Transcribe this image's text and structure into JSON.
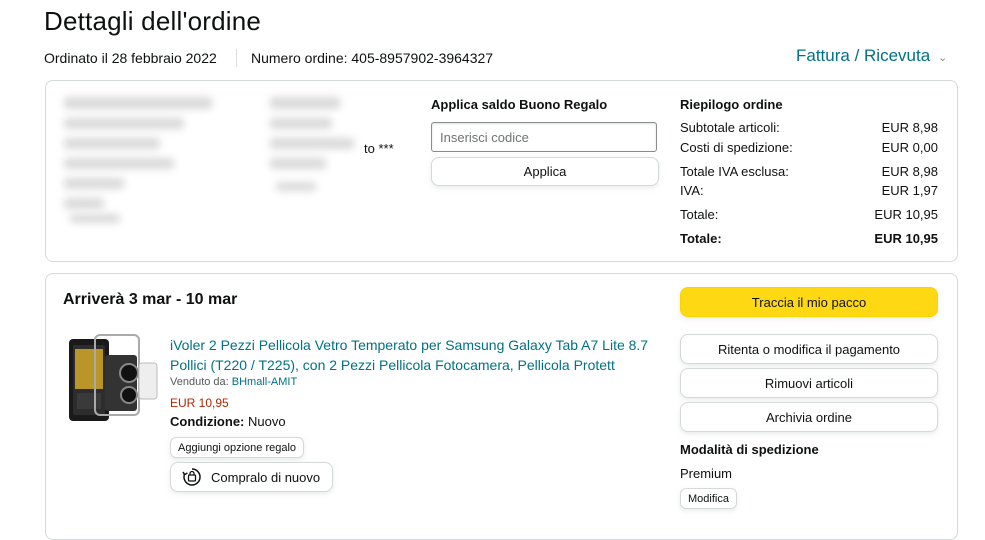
{
  "header": {
    "title": "Dettagli dell'ordine",
    "order_date": "Ordinato il 28 febbraio 2022",
    "order_number": "Numero ordine: 405-8957902-3964327",
    "invoice_link": "Fattura / Ricevuta"
  },
  "address": {
    "suffix": "to ***"
  },
  "gift_card": {
    "title": "Applica saldo Buono Regalo",
    "placeholder": "Inserisci codice",
    "value": "",
    "apply_label": "Applica"
  },
  "summary": {
    "title": "Riepilogo ordine",
    "rows": [
      {
        "label": "Subtotale articoli:",
        "value": "EUR 8,98"
      },
      {
        "label": "Costi di spedizione:",
        "value": "EUR 0,00"
      },
      {
        "label": "Totale IVA esclusa:",
        "value": "EUR 8,98"
      },
      {
        "label": "IVA:",
        "value": "EUR 1,97"
      },
      {
        "label": "Totale:",
        "value": "EUR 10,95"
      },
      {
        "label": "Totale:",
        "value": "EUR 10,95"
      }
    ]
  },
  "shipment": {
    "arrival": "Arriverà 3 mar - 10 mar",
    "product": {
      "title": "iVoler 2 Pezzi Pellicola Vetro Temperato per Samsung Galaxy Tab A7 Lite 8.7 Pollici (T220 / T225), con 2 Pezzi Pellicola Fotocamera, Pellicola Protett",
      "sold_by_label": "Venduto da: ",
      "seller": "BHmall-AMIT",
      "price": "EUR 10,95",
      "condition_label": "Condizione:",
      "condition_value": "Nuovo",
      "gift_option": "Aggiungi opzione regalo",
      "buy_again": "Compralo di nuovo"
    },
    "actions": {
      "track": "Traccia il mio pacco",
      "retry_payment": "Ritenta o modifica il pagamento",
      "remove_items": "Rimuovi articoli",
      "archive": "Archivia ordine"
    },
    "shipping_mode": {
      "title": "Modalità di spedizione",
      "value": "Premium",
      "modify": "Modifica"
    }
  },
  "colors": {
    "link": "#007185",
    "price": "#b12704",
    "primary_button": "#ffd814",
    "border": "#d5d9d9"
  }
}
